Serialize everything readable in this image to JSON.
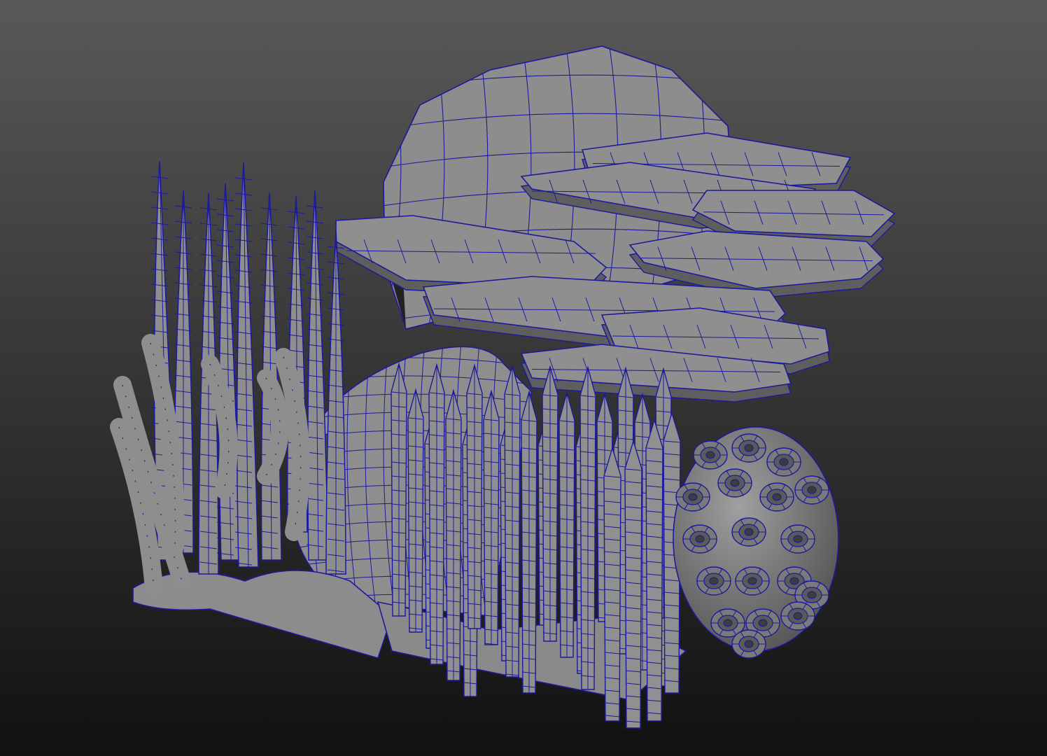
{
  "viewport": {
    "background_top": "#595959",
    "background_bottom": "#111111",
    "mesh_fill": "#8a8a8a",
    "mesh_fill_light": "#a3a3a3",
    "mesh_fill_dark": "#5e5e5e",
    "wireframe_color": "#1c1a9c",
    "display_mode": "wireframe-on-shaded"
  },
  "scene": {
    "objects": [
      "rock-boulder",
      "shelf-coral-plates",
      "branching-coral-left",
      "mound-rock-center",
      "finger-coral-cluster",
      "brain-coral-sphere"
    ]
  }
}
